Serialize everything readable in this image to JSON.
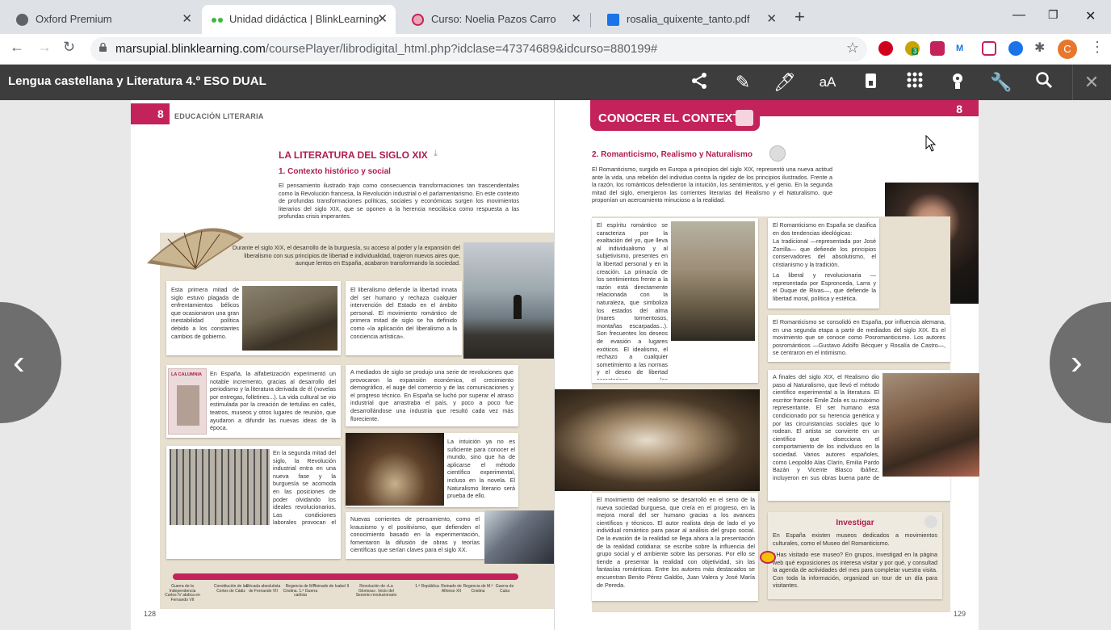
{
  "browser": {
    "tabs": [
      {
        "title": "Oxford Premium",
        "active": false
      },
      {
        "title": "Unidad didáctica | BlinkLearning",
        "active": true
      },
      {
        "title": "Curso: Noelia Pazos Carro",
        "active": false
      },
      {
        "title": "rosalia_quixente_tanto.pdf",
        "active": false
      }
    ],
    "url_host": "marsupial.blinklearning.com",
    "url_path": "/coursePlayer/librodigital_html.php?idclase=47374689&idcurso=880199#",
    "extension_badge": "3",
    "avatar_letter": "C"
  },
  "app": {
    "title": "Lengua castellana y Literatura 4.º ESO DUAL",
    "tools": [
      "share-icon",
      "pencil-icon",
      "marker-icon",
      "text-size-icon",
      "eraser-icon",
      "apps-grid-icon",
      "bulb-icon",
      "wrench-icon",
      "search-icon",
      "close-icon"
    ]
  },
  "left_page": {
    "unit_number": "8",
    "section_label": "EDUCACIÓN LITERARIA",
    "title": "LA LITERATURA DEL SIGLO XIX",
    "subtitle": "1. Contexto histórico y social",
    "intro": "El pensamiento ilustrado trajo como consecuencia transformaciones tan trascendentales como la Revolución francesa, la Revolución industrial o el parlamentarismo. En este contexto de profundas transformaciones políticas, sociales y económicas surgen los movimientos literarios del siglo XIX, que se oponen a la herencia neoclásica como respuesta a las profundas crisis imperantes.",
    "fan_text": "Durante el siglo XIX, el desarrollo de la burguesía, su acceso al poder y la expansión del liberalismo con sus principios de libertad e individualidad, trajeron nuevos aires que, aunque lentos en España, acabaron transformando la sociedad.",
    "box1": "Esta primera mitad de siglo estuvo plagada de enfrentamientos bélicos que ocasionaron una gran inestabilidad política debido a los constantes cambios de gobierno.",
    "box2": "El liberalismo defiende la libertad innata del ser humano y rechaza cualquier intervención del Estado en el ámbito personal. El movimiento romántico de primera mitad de siglo se ha definido como «la aplicación del liberalismo a la conciencia artística».",
    "box3": "En España, la alfabetización experimentó un notable incremento, gracias al desarrollo del periodismo y la literatura derivada de él (novelas por entregas, folletines...). La vida cultural se vio estimulada por la creación de tertulias en cafés, teatros, museos y otros lugares de reunión, que ayudaron a difundir las nuevas ideas de la época.",
    "box3_img_caption": "LA CALUMNIA",
    "box4": "A mediados de siglo se produjo una serie de revoluciones que provocaron la expansión económica, el crecimiento demográfico, el auge del comercio y de las comunicaciones y el progreso técnico. En España se luchó por superar el atraso industrial que arrastraba el país, y poco a poco fue desarrollándose una industria que resultó cada vez más floreciente.",
    "box5": "En la segunda mitad del siglo, la Revolución industrial entra en una nueva fase y la burguesía se acomoda en las posiciones de poder olvidando los ideales revolucionarios. Las condiciones laborales provocan el nacimiento del movimiento obrero, con un proletariado que reivindica sus derechos. El Realismo será la corriente literaria que se desarrolle en estos años.",
    "box6": "La intuición ya no es suficiente para conocer el mundo, sino que ha de aplicarse el método científico experimental, incluso en la novela. El Naturalismo literario será prueba de ello.",
    "box7": "Nuevas corrientes de pensamiento, como el krausismo y el positivismo, que defienden el conocimiento basado en la experimentación, fomentaron la difusión de obras y teorías científicas que serían claves para el siglo XX.",
    "timeline": [
      "Guerra de la Independencia Carlos IV abdica en Fernando VII",
      "Constitución de las Cortes de Cádiz",
      "Década absolutista de Fernando VII",
      "Regencia de M.ª Cristina. 1.ª Guerra carlista",
      "Reinado de Isabel II",
      "Revolución de «La Gloriosa». Inicio del Sexenio revolucionario",
      "1.ª República",
      "Reinado de Alfonso XII",
      "Regencia de M.ª Cristina",
      "Guerra de Cuba"
    ],
    "page_number": "128"
  },
  "right_page": {
    "banner": "CONOCER EL CONTEXTO",
    "unit_number": "8",
    "heading": "2. Romanticismo, Realismo y Naturalismo",
    "intro": "El Romanticismo, surgido en Europa a principios del siglo XIX, representó una nueva actitud ante la vida, una rebelión del individuo contra la rigidez de los principios ilustrados. Frente a la razón, los románticos defendieron la intuición, los sentimientos, y el genio. En la segunda mitad del siglo, emergieron las corrientes literarias del Realismo y el Naturalismo, que proponían un acercamiento minucioso a la realidad.",
    "romantic_box": "El espíritu romántico se caracteriza por la exaltación del yo, que lleva al individualismo y al subjetivismo, presentes en la libertad personal y en la creación. La primacía de los sentimientos frente a la razón está directamente relacionada con la naturaleza, que simboliza los estados del alma (mares tormentosos, montañas escarpadas...). Son frecuentes los deseos de evasión a lugares exóticos. El idealismo, el rechazo a cualquier sometimiento a las normas y el deseo de libertad caracterizan las producciones de la época.",
    "spain_box": "El Romanticismo en España se clasifica en dos tendencias ideológicas:",
    "spain_item1": "La tradicional —representada por José Zorrilla— que defiende los principios conservadores del absolutismo, el cristianismo y la tradición.",
    "spain_item2": "La liberal y revolucionaria —representada por Espronceda, Larra y el Duque de Rivas—, que defiende la libertad moral, política y estética.",
    "consolidation": "El Romanticismo se consolidó en España, por influencia alemana, en una segunda etapa a partir de mediados del siglo XIX. Es el movimiento que se conoce como Posromanticismo. Los autores posrománticos —Gustavo Adolfo Bécquer y Rosalía de Castro—, se centraron en el intimismo.",
    "naturalism": "A finales del siglo XIX, el Realismo dio paso al Naturalismo, que llevó el método científico experimental a la literatura. El escritor francés Émile Zola es su máximo representante. El ser humano está condicionado por su herencia genética y por las circunstancias sociales que lo rodean. El artista se convierte en un científico que disecciona el comportamiento de los individuos en la sociedad. Varios autores españoles, como Leopoldo Alas Clarín, Emilia Pardo Bazán y Vicente Blasco Ibáñez, incluyeron en sus obras buena parte de estos postulados.",
    "realism": "El movimiento del realismo se desarrolló en el seno de la nueva sociedad burguesa, que creía en el progreso, en la mejora moral del ser humano gracias a los avances científicos y técnicos. El autor realista deja de lado el yo individual romántico para pasar al análisis del grupo social. De la evasión de la realidad se llega ahora a la presentación de la realidad cotidiana: se escribe sobre la influencia del grupo social y el ambiente sobre las personas. Por ello se tiende a presentar la realidad con objetividad, sin las fantasías románticas. Entre los autores más destacados se encuentran Benito Pérez Galdós, Juan Valera y José María de Pereda.",
    "investigar_title": "Investigar",
    "investigar_item1": "En España existen museos dedicados a movimientos culturales, como el Museo del Romanticismo.",
    "investigar_item2": "¿Has visitado ese museo? En grupos, investigad en la página web qué exposiciones os interesa visitar y por qué, y consultad la agenda de actividades del mes para completar vuestra visita. Con toda la información, organizad un tour de un día para visitantes.",
    "page_number": "129"
  },
  "colors": {
    "accent": "#c4225a",
    "heading": "#b01d4f",
    "beige": "#e7dfcf",
    "toolbar": "#3d3d3d"
  }
}
